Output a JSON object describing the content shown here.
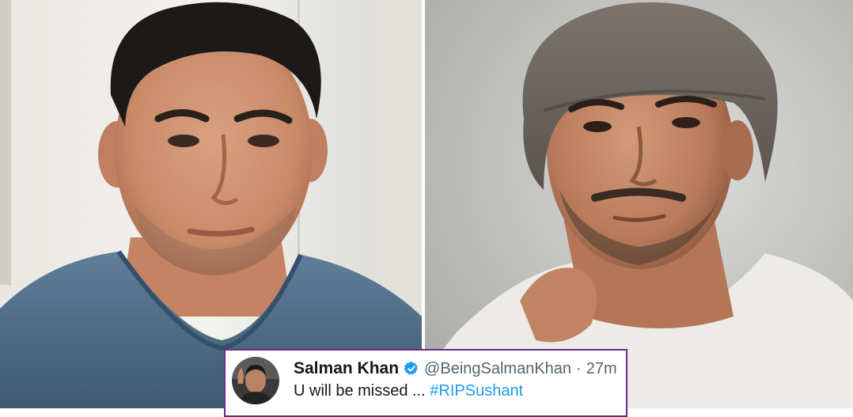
{
  "tweet": {
    "name": "Salman Khan",
    "handle": "@BeingSalmanKhan",
    "separator": "·",
    "time": "27m",
    "body_text": "U will be missed ... ",
    "hashtag": "#RIPSushant"
  },
  "colors": {
    "card_border": "#6a2a86",
    "hashtag": "#1d9bf0",
    "verified": "#1d9bf0"
  },
  "icons": {
    "verified": "verified-badge-icon"
  }
}
